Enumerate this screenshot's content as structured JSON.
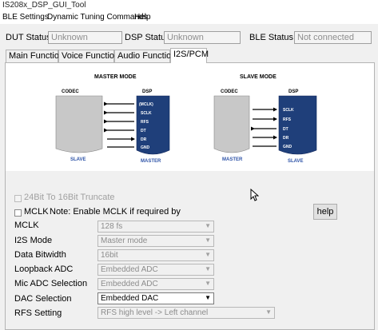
{
  "window": {
    "title": "IS208x_DSP_GUI_Tool"
  },
  "menu": [
    {
      "label": "BLE Settings"
    },
    {
      "label": "Dynamic Tuning Commands"
    },
    {
      "label": "Help"
    }
  ],
  "status": {
    "dut_label": "DUT Status",
    "dut_value": "Unknown",
    "dsp_label": "DSP Status:",
    "dsp_value": "Unknown",
    "ble_label": "BLE Status:",
    "ble_value": "Not connected"
  },
  "tabs": [
    {
      "label": "Main Function",
      "active": false
    },
    {
      "label": "Voice Function",
      "active": false
    },
    {
      "label": "Audio Function",
      "active": false
    },
    {
      "label": "I2S/PCM",
      "active": true
    }
  ],
  "diagrams": {
    "master": {
      "title": "MASTER MODE",
      "codec_label": "CODEC",
      "dsp_label": "DSP",
      "codec_role": "SLAVE",
      "dsp_role": "MASTER",
      "signals": [
        "(MCLK)",
        "SCLK",
        "RFS",
        "DT",
        "DR",
        "GND"
      ]
    },
    "slave": {
      "title": "SLAVE MODE",
      "codec_label": "CODEC",
      "dsp_label": "DSP",
      "codec_role": "MASTER",
      "dsp_role": "SLAVE",
      "signals": [
        "SCLK",
        "RFS",
        "DT",
        "DR",
        "GND"
      ]
    },
    "colors": {
      "codec": "#c8c8c8",
      "dsp": "#1f3f7a",
      "role_text": "#2f54a8"
    }
  },
  "settings": {
    "truncate_label": "24Bit To 16Bit Truncate",
    "mclk_check_label": "MCLK",
    "mclk_note": "Note: Enable MCLK if required by",
    "help_button": "help",
    "rows": [
      {
        "label": "MCLK",
        "value": "128 fs",
        "enabled": false
      },
      {
        "label": "I2S Mode",
        "value": "Master mode",
        "enabled": false
      },
      {
        "label": "Data Bitwidth",
        "value": "16bit",
        "enabled": false
      },
      {
        "label": "Loopback ADC",
        "value": "Embedded ADC",
        "enabled": false
      },
      {
        "label": "Mic ADC Selection",
        "value": "Embedded ADC",
        "enabled": false
      },
      {
        "label": "DAC Selection",
        "value": "Embedded DAC",
        "enabled": true
      },
      {
        "label": "RFS Setting",
        "value": "RFS high level -> Left channel",
        "enabled": false
      }
    ]
  }
}
